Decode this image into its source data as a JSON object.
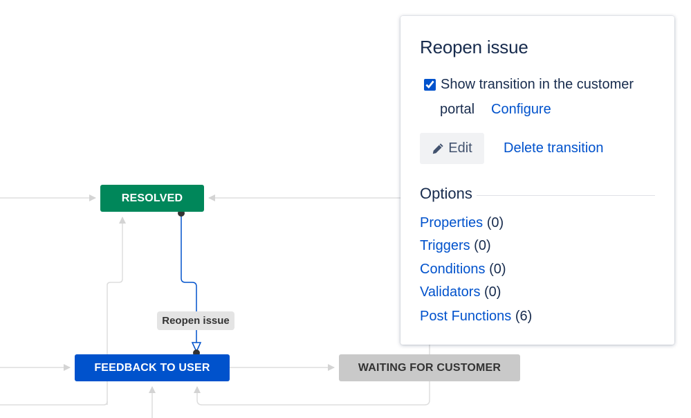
{
  "statuses": {
    "resolved": {
      "label": "RESOLVED",
      "color": "#00875a"
    },
    "feedback": {
      "label": "FEEDBACK TO USER",
      "color": "#0052cc"
    },
    "waiting": {
      "label": "WAITING FOR CUSTOMER",
      "color": "#c9c9c9"
    }
  },
  "transition_label": "Reopen issue",
  "panel": {
    "title": "Reopen issue",
    "show_in_portal_checked": true,
    "show_in_portal_line1": "Show transition in the customer",
    "show_in_portal_line2": "portal",
    "configure_link": "Configure",
    "edit_button": "Edit",
    "delete_link": "Delete transition",
    "options_heading": "Options",
    "options": [
      {
        "label": "Properties",
        "count": "(0)"
      },
      {
        "label": "Triggers",
        "count": "(0)"
      },
      {
        "label": "Conditions",
        "count": "(0)"
      },
      {
        "label": "Validators",
        "count": "(0)"
      },
      {
        "label": "Post Functions",
        "count": "(6)"
      }
    ]
  },
  "colors": {
    "link": "#0052cc",
    "connector": "#dcdcdc",
    "selected_connector": "#0052cc",
    "text_dark": "#172b4d"
  }
}
